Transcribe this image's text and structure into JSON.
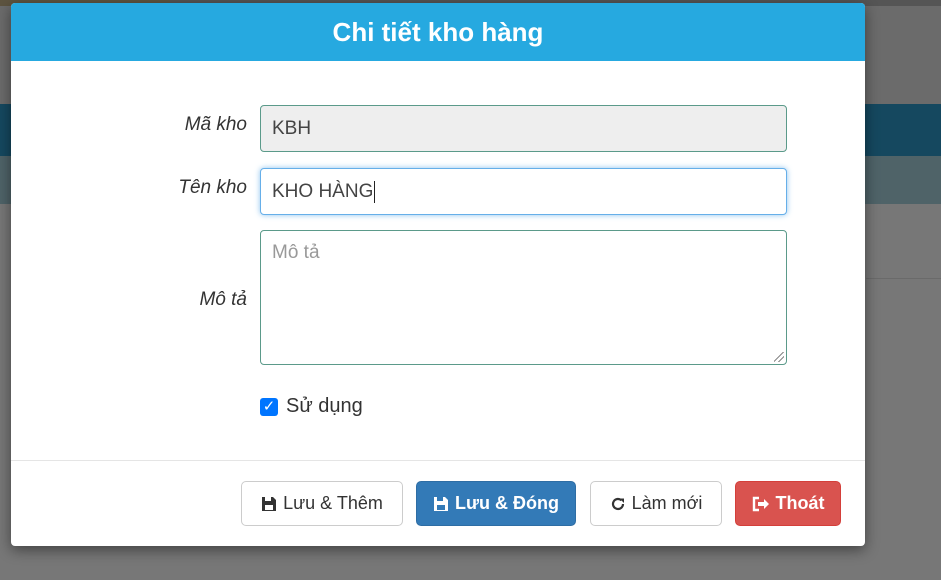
{
  "dialog": {
    "title": "Chi tiết kho hàng",
    "fields": {
      "code": {
        "label": "Mã kho",
        "value": "KBH"
      },
      "name": {
        "label": "Tên kho",
        "value": "KHO HÀNG"
      },
      "description": {
        "label": "Mô tả",
        "placeholder": "Mô tả"
      }
    },
    "active": {
      "label": "Sử dụng",
      "checked": true
    }
  },
  "buttons": {
    "save_add": {
      "label": "Lưu & Thêm",
      "icon": "floppy-disk-icon"
    },
    "save_close": {
      "label": "Lưu & Đóng",
      "icon": "floppy-disk-icon"
    },
    "refresh": {
      "label": "Làm mới",
      "icon": "refresh-icon"
    },
    "exit": {
      "label": "Thoát",
      "icon": "sign-out-icon"
    }
  },
  "colors": {
    "header": "#26a9e0",
    "primary": "#337ab7",
    "danger": "#d9534f",
    "checkbox": "#0075ff"
  }
}
